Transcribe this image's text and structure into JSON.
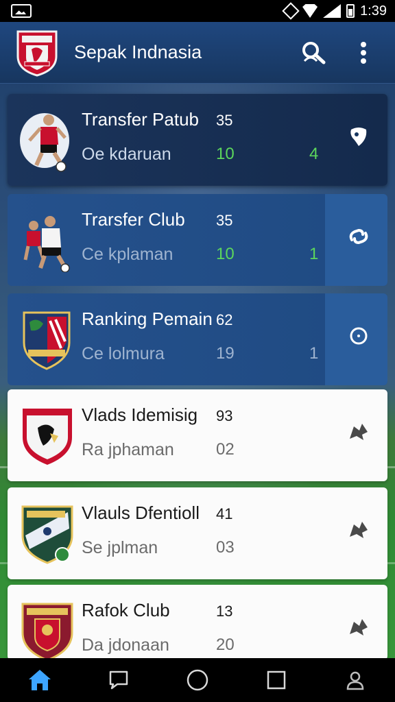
{
  "status_bar": {
    "time": "1:39"
  },
  "app_bar": {
    "title": "Sepak Indnasia"
  },
  "cards": [
    {
      "title": "Transfer Patub",
      "subtitle": "Oe kdaruan",
      "num1": "35",
      "num2": "10",
      "num3": "4",
      "action_icon": "shield-icon",
      "style": "dark"
    },
    {
      "title": "Trarsfer Club",
      "subtitle": "Ce kplaman",
      "num1": "35",
      "num2": "10",
      "num3": "1",
      "action_icon": "link-icon",
      "style": "blue"
    },
    {
      "title": "Ranking Pemain",
      "subtitle": "Ce lolmura",
      "num1": "62",
      "num2": "19",
      "num3": "1",
      "action_icon": "circle-icon",
      "style": "blue"
    },
    {
      "title": "Vlads Idemisig",
      "subtitle": "Ra jphaman",
      "num1": "93",
      "num2": "02",
      "num3": "",
      "action_icon": "arrow-icon",
      "style": "white"
    },
    {
      "title": "Vlauls Dfentioll",
      "subtitle": "Se jplman",
      "num1": "41",
      "num2": "03",
      "num3": "",
      "action_icon": "arrow-icon",
      "style": "white"
    },
    {
      "title": "Rafok Club",
      "subtitle": "Da jdonaan",
      "num1": "13",
      "num2": "20",
      "num3": "",
      "action_icon": "arrow-icon",
      "style": "white"
    }
  ],
  "bottom_nav": [
    "home-icon",
    "chat-icon",
    "circle-icon",
    "square-icon",
    "profile-icon"
  ],
  "colors": {
    "accent_green": "#5cd65c",
    "app_bar": "#1f477f",
    "home_active": "#3da5ff"
  }
}
